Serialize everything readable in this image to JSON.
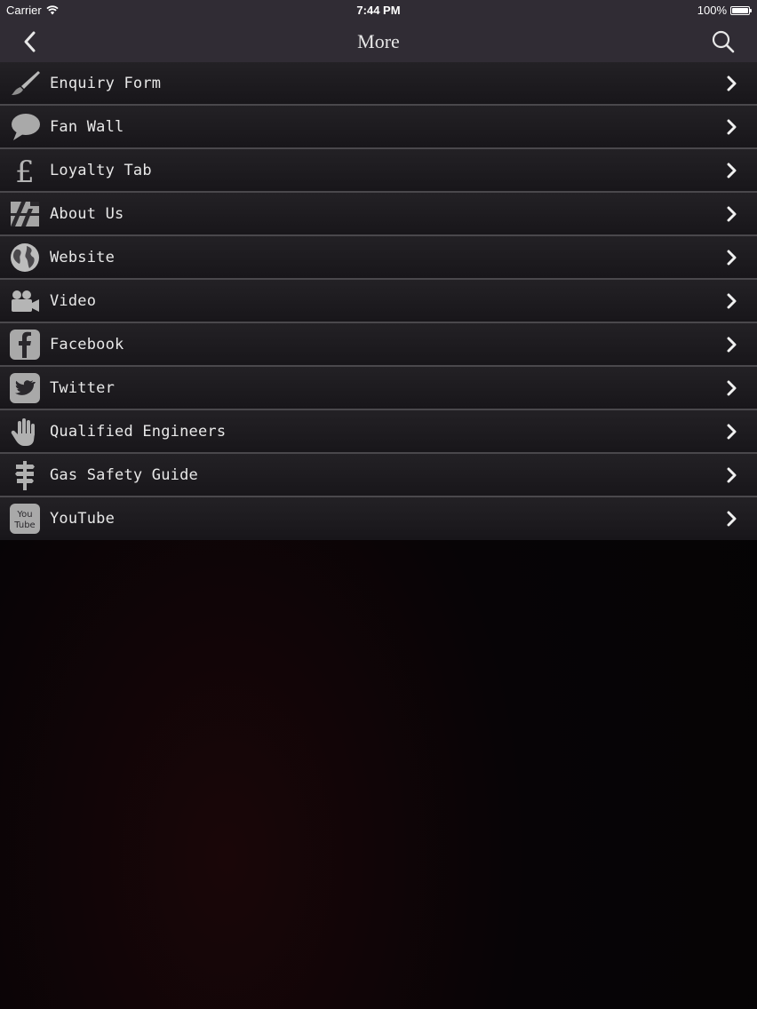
{
  "status_bar": {
    "carrier": "Carrier",
    "time": "7:44 PM",
    "battery": "100%",
    "battery_level": 1.0
  },
  "nav": {
    "title": "More",
    "back_icon": "chevron-left-icon",
    "search_icon": "search-icon"
  },
  "menu": {
    "items": [
      {
        "label": "Enquiry Form",
        "icon": "paintbrush-icon"
      },
      {
        "label": "Fan Wall",
        "icon": "speech-bubble-icon"
      },
      {
        "label": "Loyalty Tab",
        "icon": "pound-icon"
      },
      {
        "label": "About Us",
        "icon": "about-icon"
      },
      {
        "label": "Website",
        "icon": "globe-icon"
      },
      {
        "label": "Video",
        "icon": "video-camera-icon"
      },
      {
        "label": "Facebook",
        "icon": "facebook-icon"
      },
      {
        "label": "Twitter",
        "icon": "twitter-icon"
      },
      {
        "label": "Qualified Engineers",
        "icon": "hand-icon"
      },
      {
        "label": "Gas Safety Guide",
        "icon": "signpost-icon"
      },
      {
        "label": "YouTube",
        "icon": "youtube-icon",
        "icon_text_top": "You",
        "icon_text_bottom": "Tube"
      }
    ]
  },
  "colors": {
    "topbar": "#302c34",
    "row": "#1d1b1f",
    "separator": "#4a484c",
    "background": "#050305",
    "text": "#e8e8e8"
  }
}
